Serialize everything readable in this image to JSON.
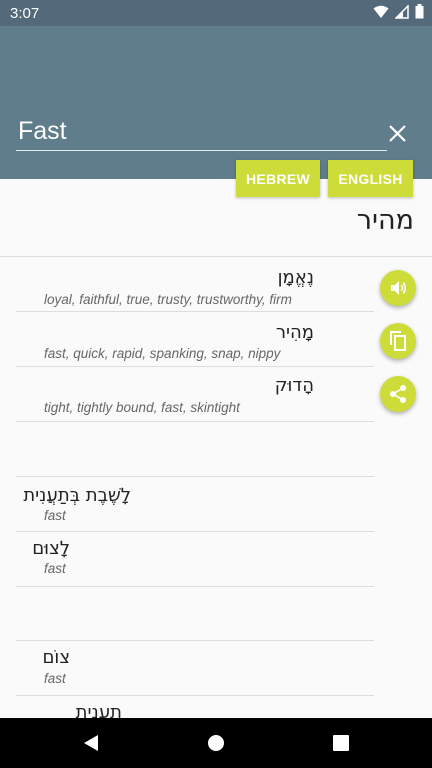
{
  "status": {
    "time": "3:07"
  },
  "search": {
    "value": "Fast"
  },
  "lang_buttons": {
    "hebrew": "HEBREW",
    "english": "ENGLISH"
  },
  "result": {
    "word": "מהיר"
  },
  "entries": [
    {
      "hebrew": "נֶאֱמָן",
      "translations": "loyal, faithful, true, trusty, trustworthy, firm"
    },
    {
      "hebrew": "מָהִיר",
      "translations": "fast, quick, rapid, spanking, snap, nippy"
    },
    {
      "hebrew": "הָדוּק",
      "translations": "tight, tightly bound, fast, skintight"
    },
    {
      "hebrew": "לָשֶׁבֶת בְּתַעֲנִית",
      "translations": "fast"
    },
    {
      "hebrew": "לָצוּם",
      "translations": "fast"
    },
    {
      "hebrew": "צוֹם",
      "translations": "fast"
    },
    {
      "hebrew": "תַעֲנִית",
      "translations": ""
    }
  ],
  "icons": {
    "wifi": "wifi-icon",
    "signal": "signal-icon",
    "battery": "battery-icon",
    "clear": "close-icon",
    "speak": "volume-icon",
    "copy": "copy-icon",
    "share": "share-icon",
    "back": "back-icon",
    "home": "home-icon",
    "recents": "recents-icon"
  },
  "colors": {
    "appbar": "#607d8b",
    "statusbar": "#546a7a",
    "accent": "#cddc39"
  }
}
